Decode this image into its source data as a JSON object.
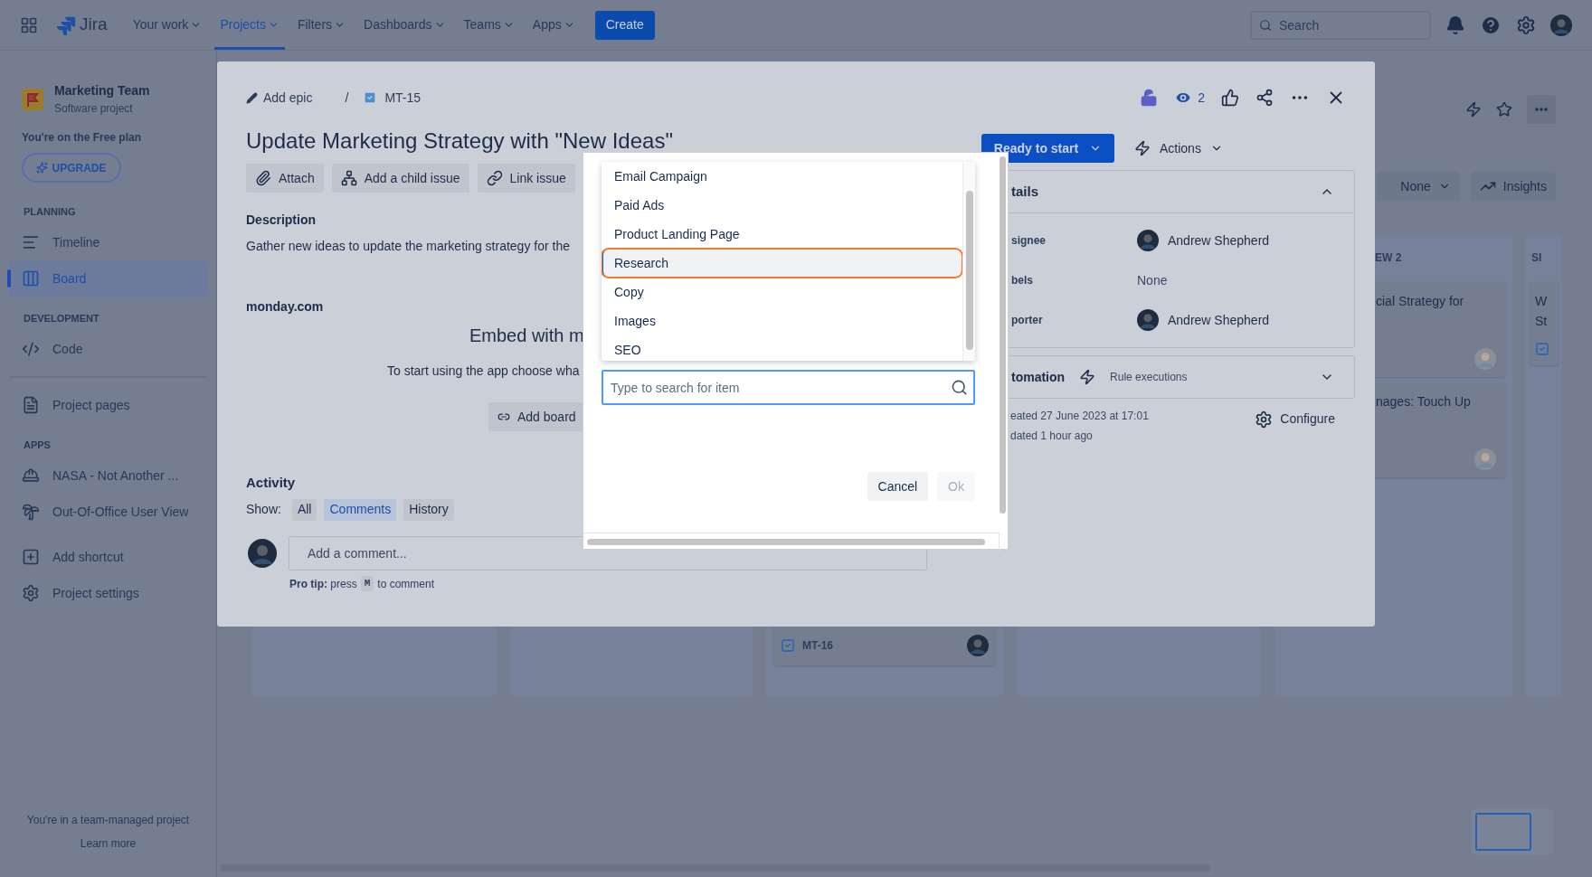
{
  "top_nav": {
    "product": "Jira",
    "items": [
      {
        "label": "Your work",
        "selected": false
      },
      {
        "label": "Projects",
        "selected": true
      },
      {
        "label": "Filters",
        "selected": false
      },
      {
        "label": "Dashboards",
        "selected": false
      },
      {
        "label": "Teams",
        "selected": false
      },
      {
        "label": "Apps",
        "selected": false
      }
    ],
    "create": "Create",
    "search": {
      "placeholder": "Search"
    }
  },
  "sidebar": {
    "project": {
      "name": "Marketing Team",
      "type": "Software project"
    },
    "plan_note": "You're on the Free plan",
    "upgrade": "UPGRADE",
    "groups": [
      {
        "heading": "PLANNING",
        "items": [
          {
            "label": "Timeline",
            "selected": false
          },
          {
            "label": "Board",
            "selected": true
          }
        ]
      },
      {
        "heading": "DEVELOPMENT",
        "items": [
          {
            "label": "Code",
            "selected": false
          }
        ]
      },
      {
        "items": [
          {
            "label": "Project pages",
            "selected": false
          }
        ]
      },
      {
        "heading": "APPS",
        "items": [
          {
            "label": "NASA - Not Another ...",
            "selected": false
          },
          {
            "label": "Out-Of-Office User View",
            "selected": false
          }
        ]
      },
      {
        "items": [
          {
            "label": "Add shortcut",
            "selected": false
          },
          {
            "label": "Project settings",
            "selected": false
          }
        ]
      }
    ],
    "footer": {
      "note": "You're in a team-managed project",
      "link": "Learn more"
    }
  },
  "board": {
    "group_by": "None",
    "insights": "Insights",
    "columns": [
      {},
      {},
      {
        "cards": [
          {
            "key": "MT-16"
          }
        ]
      },
      {},
      {
        "title": "EW 2",
        "cards": [
          {
            "lines": [
              "cial Strategy for"
            ]
          },
          {
            "lines": [
              "nages: Touch Up"
            ]
          }
        ]
      },
      {
        "title": "SI",
        "cards": [
          {
            "lines": [
              "W",
              "St"
            ],
            "checked": true
          }
        ]
      }
    ]
  },
  "issue": {
    "breadcrumb": {
      "epic": "Add epic",
      "separator": "/",
      "key": "MT-15"
    },
    "watchers": "2",
    "title": "Update Marketing Strategy with \"New Ideas\"",
    "actions": [
      "Attach",
      "Add a child issue",
      "Link issue"
    ],
    "description": {
      "heading": "Description",
      "text": "Gather new ideas to update the marketing strategy for the"
    },
    "app_panel": {
      "name": "monday.com",
      "heading": "Embed with m",
      "text": "To start using the app choose wha",
      "button": "Add board"
    },
    "activity": {
      "heading": "Activity",
      "show_label": "Show:",
      "filters": [
        {
          "label": "All",
          "selected": false
        },
        {
          "label": "Comments",
          "selected": true
        },
        {
          "label": "History",
          "selected": false
        }
      ],
      "comment_placeholder": "Add a comment...",
      "tip": "**Pro tip:** press",
      "tip_key": "M",
      "tip_end": "to comment"
    },
    "status": "Ready to start",
    "actions_menu": "Actions",
    "details": {
      "heading": "tails",
      "expanded": true,
      "fields": [
        {
          "label": "signee",
          "value": "Andrew Shepherd",
          "kind": "person"
        },
        {
          "label": "bels",
          "value": "None",
          "kind": "text"
        },
        {
          "label": "porter",
          "value": "Andrew Shepherd",
          "kind": "person"
        }
      ]
    },
    "automation": {
      "heading": "tomation",
      "link": "Rule executions",
      "expanded": false
    },
    "created": "eated 27 June 2023 at 17:01",
    "updated": "dated 1 hour ago",
    "configure": "Configure"
  },
  "picker": {
    "items": [
      {
        "label": "Email Campaign",
        "selected": false
      },
      {
        "label": "Paid Ads",
        "selected": false
      },
      {
        "label": "Product Landing Page",
        "selected": false
      },
      {
        "label": "Research",
        "selected": true
      },
      {
        "label": "Copy",
        "selected": false
      },
      {
        "label": "Images",
        "selected": false
      },
      {
        "label": "SEO",
        "selected": false
      }
    ],
    "search": {
      "placeholder": "Type to search for item"
    },
    "cancel": "Cancel",
    "ok": {
      "label": "Ok",
      "disabled": true
    }
  }
}
